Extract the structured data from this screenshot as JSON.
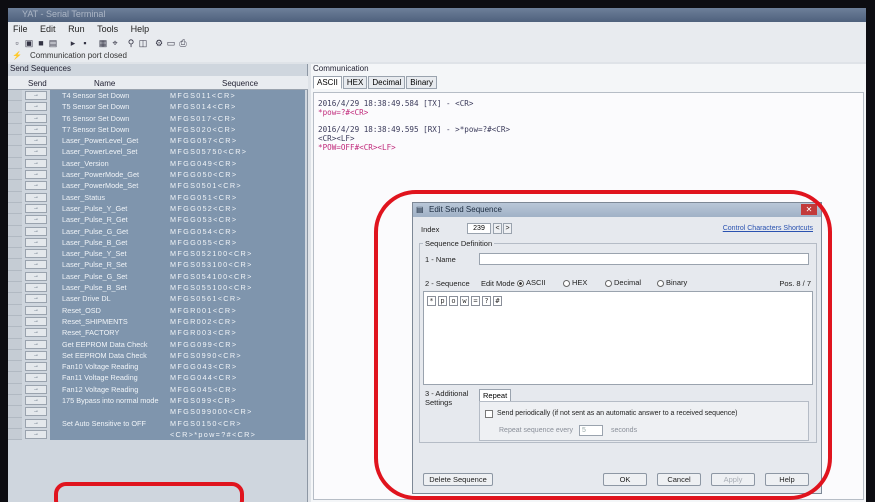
{
  "window": {
    "title": "YAT - Serial Terminal"
  },
  "menu": [
    "File",
    "Edit",
    "Run",
    "Tools",
    "Help"
  ],
  "status": {
    "connection": "Communication port closed"
  },
  "send_panel": {
    "title": "Send Sequences",
    "columns": {
      "send": "Send",
      "name": "Name",
      "sequence": "Sequence"
    },
    "send_label": "→",
    "rows": [
      {
        "name": "T4 Sensor Set Down",
        "seq": "MFGS011<CR>"
      },
      {
        "name": "T5 Sensor Set Down",
        "seq": "MFGS014<CR>"
      },
      {
        "name": "T6 Sensor Set Down",
        "seq": "MFGS017<CR>"
      },
      {
        "name": "T7 Sensor Set Down",
        "seq": "MFGS020<CR>"
      },
      {
        "name": "Laser_PowerLevel_Get",
        "seq": "MFGG057<CR>"
      },
      {
        "name": "Laser_PowerLevel_Set",
        "seq": "MFGS05750<CR>"
      },
      {
        "name": "Laser_Version",
        "seq": "MFGG049<CR>"
      },
      {
        "name": "Laser_PowerMode_Get",
        "seq": "MFGG050<CR>"
      },
      {
        "name": "Laser_PowerMode_Set",
        "seq": "MFGS0501<CR>"
      },
      {
        "name": "Laser_Status",
        "seq": "MFGG051<CR>"
      },
      {
        "name": "Laser_Pulse_Y_Get",
        "seq": "MFGG052<CR>"
      },
      {
        "name": "Laser_Pulse_R_Get",
        "seq": "MFGG053<CR>"
      },
      {
        "name": "Laser_Pulse_G_Get",
        "seq": "MFGG054<CR>"
      },
      {
        "name": "Laser_Pulse_B_Get",
        "seq": "MFGG055<CR>"
      },
      {
        "name": "Laser_Pulse_Y_Set",
        "seq": "MFGS052100<CR>"
      },
      {
        "name": "Laser_Pulse_R_Set",
        "seq": "MFGS053100<CR>"
      },
      {
        "name": "Laser_Pulse_G_Set",
        "seq": "MFGS054100<CR>"
      },
      {
        "name": "Laser_Pulse_B_Set",
        "seq": "MFGS055100<CR>"
      },
      {
        "name": "Laser Drive DL",
        "seq": "MFGS0561<CR>"
      },
      {
        "name": "Reset_OSD",
        "seq": "MFGR001<CR>"
      },
      {
        "name": "Reset_SHIPMENTS",
        "seq": "MFGR002<CR>"
      },
      {
        "name": "Reset_FACTORY",
        "seq": "MFGR003<CR>"
      },
      {
        "name": "Get EEPROM Data Check",
        "seq": "MFGG099<CR>"
      },
      {
        "name": "Set EEPROM Data Check",
        "seq": "MFGS0990<CR>"
      },
      {
        "name": "Fan10 Voltage Reading",
        "seq": "MFGG043<CR>"
      },
      {
        "name": "Fan11 Voltage Reading",
        "seq": "MFGG044<CR>"
      },
      {
        "name": "Fan12 Voltage Reading",
        "seq": "MFGG045<CR>"
      },
      {
        "name": "175 Bypass into normal mode",
        "seq": "MFGS099<CR>"
      },
      {
        "name": "",
        "seq": "MFGS099000<CR>"
      },
      {
        "name": "Set Auto Sensitive to OFF",
        "seq": "MFGS0150<CR>"
      },
      {
        "name": "",
        "seq": "<CR>*pow=?#<CR>"
      }
    ]
  },
  "comm_panel": {
    "title": "Communication",
    "tabs": [
      "ASCII",
      "HEX",
      "Decimal",
      "Binary"
    ],
    "log": [
      {
        "text": "2016/4/29 18:38:49.584 [TX] - <CR>",
        "style": "normal"
      },
      {
        "text": "*pow=?#<CR>",
        "style": "red"
      },
      {
        "text": "2016/4/29 18:38:49.595 [RX] - >*pow=?#<CR>",
        "style": "normal"
      },
      {
        "text": "<CR><LF>",
        "style": "normal"
      },
      {
        "text": "*POW=OFF#<CR><LF>",
        "style": "red"
      }
    ]
  },
  "dialog": {
    "title": "Edit Send Sequence",
    "index_label": "Index",
    "index_value": "239",
    "prev": "<",
    "next": ">",
    "shortcuts_link": "Control Characters Shortcuts",
    "definition_label": "Sequence Definition",
    "name_label": "1 - Name",
    "name_value": "",
    "sequence_label": "2 - Sequence",
    "edit_mode_label": "Edit Mode",
    "modes": [
      "ASCII",
      "HEX",
      "Decimal",
      "Binary"
    ],
    "selected_mode": "ASCII",
    "position": "Pos. 8 / 7",
    "chars": [
      "*",
      "p",
      "o",
      "w",
      "=",
      "?",
      "#"
    ],
    "additional_label": "3 - Additional Settings",
    "repeat_tab": "Repeat",
    "send_periodically": "Send periodically (if not sent as an automatic answer to a received sequence)",
    "repeat_every_label": "Repeat sequence every",
    "repeat_value": "5",
    "seconds_label": "seconds",
    "buttons": {
      "delete": "Delete Sequence",
      "ok": "OK",
      "cancel": "Cancel",
      "apply": "Apply",
      "help": "Help"
    }
  },
  "colors": {
    "highlight_ring": "#e0141e",
    "row_fill": "#7f95ad"
  }
}
